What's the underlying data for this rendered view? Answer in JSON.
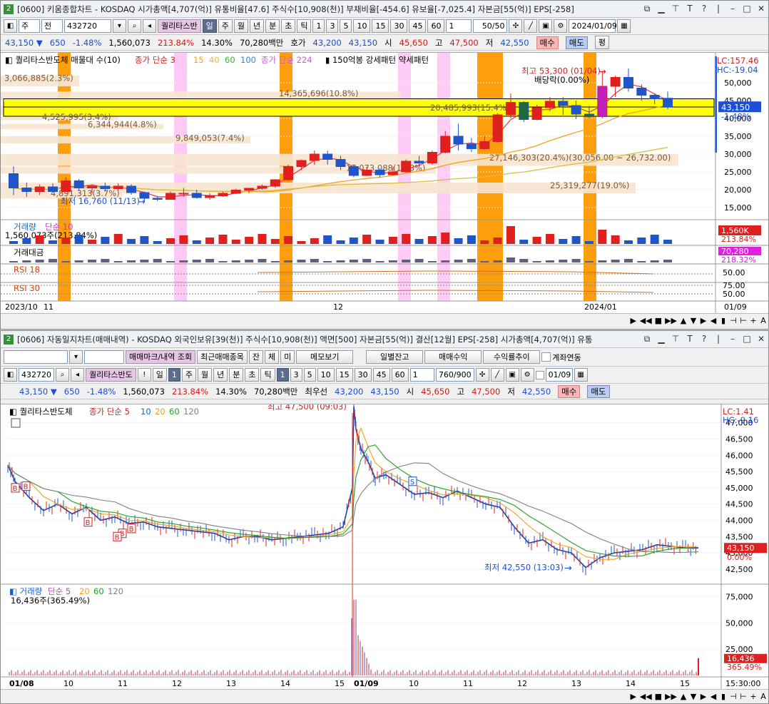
{
  "top": {
    "window_num": "2",
    "title": "[0600] 키움종합차트 - KOSDAQ 시가총액[4,707(억)] 유통비율[47.6] 주식수[10,908(천)] 부채비율[-454.6] 유보율[-7,025.4] 자본금[55(억)] EPS[-258]",
    "toolbar": {
      "market": "주",
      "mode": "전",
      "code": "432720",
      "name": "퀄리타스반",
      "periods": [
        "일",
        "주",
        "월",
        "년",
        "분",
        "초",
        "틱"
      ],
      "ticks": [
        "1",
        "3",
        "5",
        "10",
        "15",
        "30",
        "45",
        "60"
      ],
      "count_value": "1",
      "range": "50/50",
      "date": "2024/01/09"
    },
    "quote": {
      "price": "43,150",
      "arrow": "▼",
      "change": "650",
      "rate": "-1.48%",
      "volume": "1,560,073",
      "vol_rate": "213.84%",
      "turnover": "14.30%",
      "amount": "70,280백만",
      "bid_label": "호가",
      "bid": "43,200",
      "ask": "43,150",
      "open_label": "시",
      "open": "45,650",
      "high_label": "고",
      "high": "47,500",
      "low_label": "저",
      "low": "42,550",
      "buy": "매수",
      "sell": "매도",
      "eval": "평"
    },
    "legend": {
      "name": "퀄리타스반도체 매물대 수(10)",
      "ma_label": "종가 단순 3",
      "ma": [
        "15",
        "40",
        "60",
        "100"
      ],
      "ma2_label": "종가 단순 224",
      "extra": "150억봉 강세패턴 약세패턴"
    },
    "lc": "LC:157.46",
    "hc": "HC:-19.04",
    "price_axis": [
      "50,000",
      "45,000",
      "40,000",
      "35,000",
      "30,000",
      "25,000",
      "20,000",
      "15,000"
    ],
    "current_price_tag": "43,150",
    "current_rate_tag": "-1.48%",
    "volume_profile": [
      {
        "label": "3,066,885(2.3%)"
      },
      {
        "label": "14,365,696(10.8%)"
      },
      {
        "label": "20,485,993(15.4%)"
      },
      {
        "label": "4,525,995(3.4%)"
      },
      {
        "label": "6,344,944(4.8%)"
      },
      {
        "label": "9,849,053(7.4%)"
      },
      {
        "label": "27,146,303(20.4%)(30,056.00 ~ 26,732.00)"
      },
      {
        "label": "17,073,088(12.8%)"
      },
      {
        "label": "25,319,277(19.0%)"
      },
      {
        "label": "4,891,313(3.7%)"
      }
    ],
    "annotations": {
      "high": "최고 53,300 (01/04)",
      "dividend": "배당락(0.00%)",
      "low": "최저 16,760 (11/13)"
    },
    "vol_panel": {
      "label": "거래량",
      "ma": "단순 10",
      "value": "1,560,073주(213.84%)",
      "tag": "1,560K",
      "tag2": "213.84%"
    },
    "amount_panel": {
      "label": "거래대금",
      "tag": "70,280",
      "tag2": "218.32%"
    },
    "rsi18": {
      "label": "RSI 18",
      "ticks": [
        "50.00"
      ]
    },
    "rsi30": {
      "label": "RSI 30",
      "ticks": [
        "75.00",
        "50.00"
      ]
    },
    "x_axis": {
      "left": "2023/10",
      "l2": "11",
      "mid": "12",
      "r1": "2024/01",
      "right": "01/09"
    },
    "nav": [
      "▶",
      "◀◀",
      "■",
      "▶▶",
      "",
      "▲",
      "▼",
      "▶",
      "◀",
      "▮",
      "⊣",
      "⊢",
      "+",
      "A"
    ],
    "candles": [
      [
        24500,
        26500,
        18500,
        20500
      ],
      [
        20500,
        22000,
        18000,
        19500
      ],
      [
        19500,
        21500,
        18500,
        20800
      ],
      [
        20800,
        21800,
        19200,
        19500
      ],
      [
        19500,
        23500,
        19300,
        22500
      ],
      [
        22500,
        23000,
        19800,
        20500
      ],
      [
        20500,
        21500,
        19000,
        21000
      ],
      [
        21000,
        22000,
        19500,
        20300
      ],
      [
        20300,
        21800,
        19800,
        21000
      ],
      [
        21000,
        21500,
        18600,
        19200
      ],
      [
        19200,
        19500,
        16760,
        17600
      ],
      [
        17600,
        18200,
        16800,
        17300
      ],
      [
        17300,
        19500,
        17200,
        19000
      ],
      [
        19000,
        20500,
        18000,
        19000
      ],
      [
        19000,
        20000,
        17500,
        17800
      ],
      [
        17800,
        19000,
        17200,
        18300
      ],
      [
        18300,
        19500,
        18000,
        19000
      ],
      [
        19000,
        20300,
        18800,
        19900
      ],
      [
        19900,
        20500,
        19000,
        20400
      ],
      [
        20400,
        21500,
        20000,
        21000
      ],
      [
        21000,
        23000,
        20500,
        22800
      ],
      [
        22800,
        27000,
        22500,
        26500
      ],
      [
        26500,
        28500,
        25500,
        28200
      ],
      [
        28200,
        31000,
        27000,
        30000
      ],
      [
        30000,
        31000,
        27000,
        28500
      ],
      [
        28500,
        29500,
        25500,
        26500
      ],
      [
        26500,
        27000,
        23500,
        24000
      ],
      [
        24000,
        26500,
        23800,
        25500
      ],
      [
        25500,
        26000,
        23500,
        24200
      ],
      [
        24200,
        26500,
        24000,
        25000
      ],
      [
        25000,
        28500,
        24800,
        28000
      ],
      [
        28000,
        29500,
        26500,
        27500
      ],
      [
        27500,
        31000,
        27000,
        30500
      ],
      [
        30500,
        36500,
        30200,
        35000
      ],
      [
        35000,
        38500,
        31000,
        32800
      ],
      [
        32800,
        34500,
        30500,
        31500
      ],
      [
        31500,
        35000,
        31200,
        33500
      ],
      [
        33500,
        41500,
        33200,
        41000
      ],
      [
        41000,
        47000,
        40000,
        44500
      ],
      [
        44500,
        44800,
        39000,
        39700
      ],
      [
        39700,
        43800,
        39500,
        43000
      ],
      [
        43000,
        46000,
        42000,
        44800
      ],
      [
        44800,
        46000,
        41000,
        43600
      ],
      [
        43600,
        45000,
        39800,
        41200
      ],
      [
        41200,
        43500,
        40000,
        40500
      ],
      [
        40500,
        53300,
        40000,
        49000
      ],
      [
        49000,
        52000,
        46000,
        51500
      ],
      [
        51500,
        54000,
        47500,
        48500
      ],
      [
        48500,
        49500,
        45000,
        46500
      ],
      [
        46500,
        47000,
        44000,
        45500
      ],
      [
        45650,
        47500,
        42550,
        43150
      ]
    ]
  },
  "bottom": {
    "window_num": "2",
    "title": "[0606] 자동일지차트(매매내역) - KOSDAQ 외국인보유[39(천)] 주식수[10,908(천)] 액면[500] 자본금[55(억)] 결산[12월] EPS[-258] 시가총액[4,707(억)] 유통",
    "toolbar1": {
      "mark": "매매마크/내역 조회",
      "recent": "최근매매종목",
      "b1": "잔",
      "b2": "체",
      "b3": "미",
      "memo": "메모보기",
      "daily": "일별잔고",
      "profit": "매매수익",
      "rate": "수익률추이",
      "link": "계좌연동"
    },
    "toolbar2": {
      "code": "432720",
      "name": "퀄리타스반도",
      "periods": [
        "일",
        "주",
        "월",
        "년",
        "분",
        "초",
        "틱"
      ],
      "ticks": [
        "1",
        "3",
        "5",
        "10",
        "15",
        "30",
        "45",
        "60"
      ],
      "count_value": "1",
      "range": "760/900",
      "date": "01/09"
    },
    "quote": {
      "price": "43,150",
      "arrow": "▼",
      "change": "650",
      "rate": "-1.48%",
      "volume": "1,560,073",
      "vol_rate": "213.84%",
      "turnover": "14.30%",
      "amount": "70,280백만",
      "bid_label": "최우선",
      "bid": "43,200",
      "ask": "43,150",
      "open_label": "시",
      "open": "45,650",
      "high_label": "고",
      "high": "47,500",
      "low_label": "저",
      "low": "42,550",
      "buy": "매수",
      "sell": "매도"
    },
    "legend": {
      "name": "퀄리타스반도체",
      "ma_label": "종가 단순 5",
      "ma": [
        "10",
        "20",
        "60",
        "120"
      ]
    },
    "lc": "LC:1.41",
    "hc": "HC:-9.16",
    "price_axis": [
      "47,000",
      "46,500",
      "46,000",
      "45,500",
      "45,000",
      "44,500",
      "44,000",
      "43,500",
      "43,000",
      "42,500"
    ],
    "current_price_tag": "43,150",
    "current_rate_tag": "0.00%",
    "annotations": {
      "high": "최고 47,500 (09:03)",
      "low": "최저 42,550 (13:03)"
    },
    "markers": {
      "buy": "B",
      "sell": "S"
    },
    "vol_panel": {
      "label": "거래량",
      "ma_label": "단순 5",
      "ma": [
        "20",
        "60",
        "120"
      ],
      "value": "16,436주(365.49%)",
      "ticks": [
        "75,000",
        "50,000",
        "25,000"
      ],
      "tag": "16,436",
      "tag2": "365.49%"
    },
    "x_axis": [
      "01/08",
      "10",
      "11",
      "12",
      "13",
      "14",
      "15",
      "01/09",
      "10",
      "11",
      "12",
      "13",
      "14",
      "15"
    ],
    "x_axis_right": "15:30:00",
    "nav": [
      "▶",
      "◀◀",
      "■",
      "▶▶",
      "",
      "▲",
      "▼",
      "▶",
      "◀",
      "▮",
      "⊣",
      "⊢",
      "+",
      "A"
    ]
  },
  "colors": {
    "up": "#e01f1f",
    "down": "#1f55c8",
    "vp_fill": "#f8e4d0",
    "vp_text": "#7a5a3a",
    "highlight": "#ffff00",
    "event": "#ff9900",
    "pink": "#ffc6f4"
  }
}
